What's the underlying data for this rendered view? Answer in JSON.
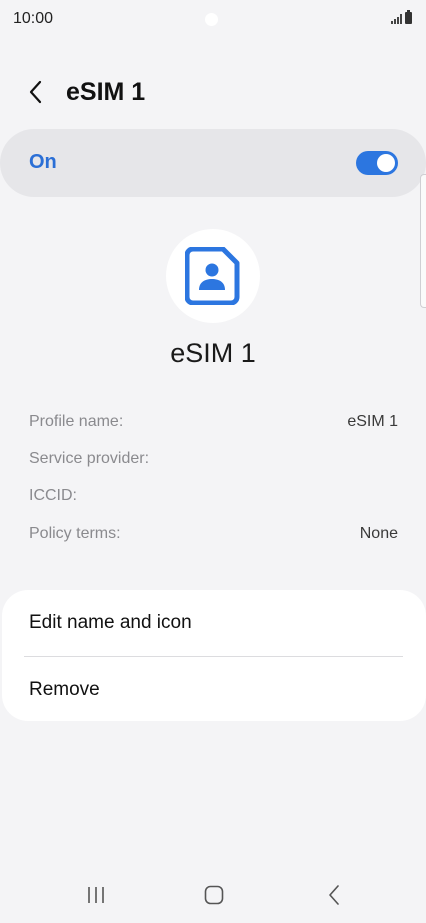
{
  "status_bar": {
    "time": "10:00",
    "icons": [
      "camera-cutout",
      "signal-icon",
      "battery-icon"
    ]
  },
  "header": {
    "back_icon": "chevron-left-icon",
    "title": "eSIM 1"
  },
  "toggle": {
    "label": "On",
    "state": true
  },
  "sim_profile": {
    "icon": "sim-card-person-icon",
    "name": "eSIM 1"
  },
  "details": [
    {
      "label": "Profile name:",
      "value": "eSIM 1"
    },
    {
      "label": "Service provider:",
      "value": ""
    },
    {
      "label": "ICCID:",
      "value": ""
    },
    {
      "label": "Policy terms:",
      "value": "None"
    }
  ],
  "actions": [
    {
      "label": "Edit name and icon"
    },
    {
      "label": "Remove"
    }
  ],
  "nav_bar": {
    "icons": [
      "recents-icon",
      "home-icon",
      "back-icon"
    ]
  },
  "colors": {
    "accent": "#2c76e0",
    "accent_text": "#2b6fd6",
    "background": "#f4f4f6",
    "card": "#e6e6e9"
  }
}
